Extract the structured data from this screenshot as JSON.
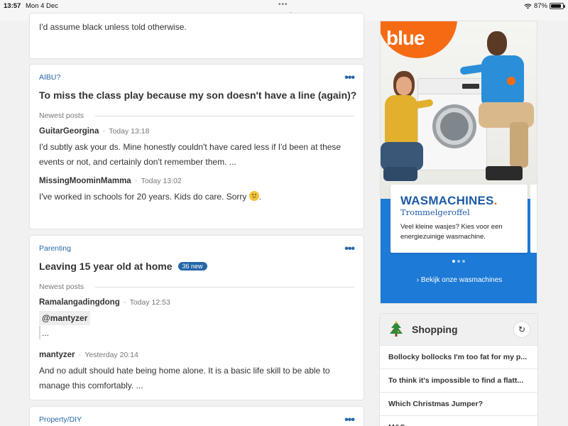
{
  "status_bar": {
    "time": "13:57",
    "date": "Mon 4 Dec",
    "url": "mumsnet.com",
    "battery": "87%",
    "battery_level": 0.87
  },
  "card0": {
    "body": "I'd assume black unless told otherwise."
  },
  "card1": {
    "category": "AIBU?",
    "more": "•••",
    "title": "To miss the class play because my son doesn't have a line (again)?",
    "newest_label": "Newest posts",
    "posts": [
      {
        "user": "GuitarGeorgina",
        "time": "Today 13:18",
        "body": "I'd subtly ask your ds. Mine honestly couldn't have cared less if I'd been at these events or not, and certainly don't remember them. ..."
      },
      {
        "user": "MissingMoominMamma",
        "time": "Today 13:02",
        "body": "I've worked in schools for 20 years. Kids do care. Sorry",
        "emoji": "disappointed-face",
        "suffix": "."
      }
    ]
  },
  "card2": {
    "category": "Parenting",
    "more": "•••",
    "title": "Leaving 15 year old at home",
    "badge": "36 new",
    "newest_label": "Newest posts",
    "posts": [
      {
        "user": "Ramalangadingdong",
        "time": "Today 12:53",
        "quote": "@mantyzer",
        "body": "..."
      },
      {
        "user": "mantyzer",
        "time": "Yesterday 20:14",
        "body": "And no adult should hate being home alone. It is a basic life skill to be able to manage this comfortably. ..."
      }
    ]
  },
  "card3": {
    "category": "Property/DIY",
    "more": "•••"
  },
  "ad": {
    "logo": "blue",
    "brand": "WASMACHINES",
    "brand_dot": ".",
    "sub": "Trommelgeroffel",
    "desc": "Veel kleine wasjes? Kies voor een energiezuinige wasmachine.",
    "cta": "Bekijk onze wasmachines",
    "colors": {
      "orange": "#f56b14",
      "blue": "#1d7ad6",
      "navy": "#1d5aa6"
    }
  },
  "shopping": {
    "title": "Shopping",
    "icon": "christmas-tree-icon",
    "items": [
      "Bollocky bollocks I'm too fat for my p...",
      "To think it's impossible to find a flatt...",
      "Which Christmas Jumper?",
      "M&S"
    ]
  }
}
